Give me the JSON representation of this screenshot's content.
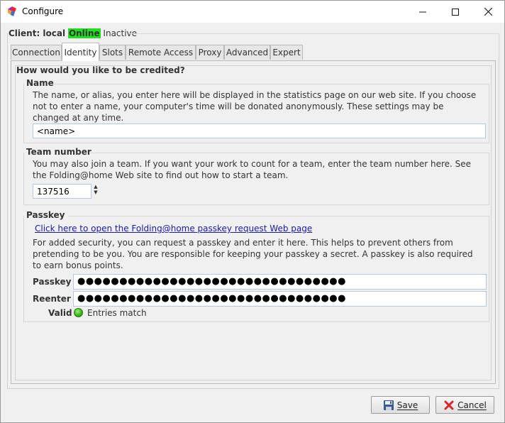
{
  "window": {
    "title": "Configure",
    "app_icon": "folding-at-home-logo"
  },
  "client": {
    "label": "Client: local",
    "status": "Online",
    "state": "Inactive",
    "status_color": "#22dd22"
  },
  "tabs": [
    {
      "label": "Connection",
      "active": false
    },
    {
      "label": "Identity",
      "active": true
    },
    {
      "label": "Slots",
      "active": false
    },
    {
      "label": "Remote Access",
      "active": false
    },
    {
      "label": "Proxy",
      "active": false
    },
    {
      "label": "Advanced",
      "active": false
    },
    {
      "label": "Expert",
      "active": false
    }
  ],
  "identity": {
    "heading": "How would you like to be credited?",
    "name": {
      "title": "Name",
      "description": "The name, or alias, you enter here will be displayed in the statistics page on our web site.  If you choose not to enter a name, your computer's time will be donated anonymously.  These settings may be changed at any time.",
      "value": "<name>"
    },
    "team": {
      "title": "Team number",
      "description": "You may also join a team.  If you want your work to count for a team, enter the team number here.  See the Folding@home Web site to find out how to start a team.",
      "value": "137516"
    },
    "passkey": {
      "title": "Passkey",
      "link": "Click here to open the Folding@home passkey request Web page",
      "description": "For added security, you can request a passkey and enter it here.  This helps to prevent others from pretending to be you.  You are responsible for keeping your passkey a secret.  A passkey is also required to earn bonus points.",
      "passkey_label": "Passkey",
      "passkey_value": "●●●●●●●●●●●●●●●●●●●●●●●●●●●●●●●●",
      "reenter_label": "Reenter",
      "reenter_value": "●●●●●●●●●●●●●●●●●●●●●●●●●●●●●●●●",
      "valid_label": "Valid",
      "valid_text": "Entries match",
      "valid_color": "#38b818"
    }
  },
  "buttons": {
    "save": "Save",
    "cancel": "Cancel"
  }
}
